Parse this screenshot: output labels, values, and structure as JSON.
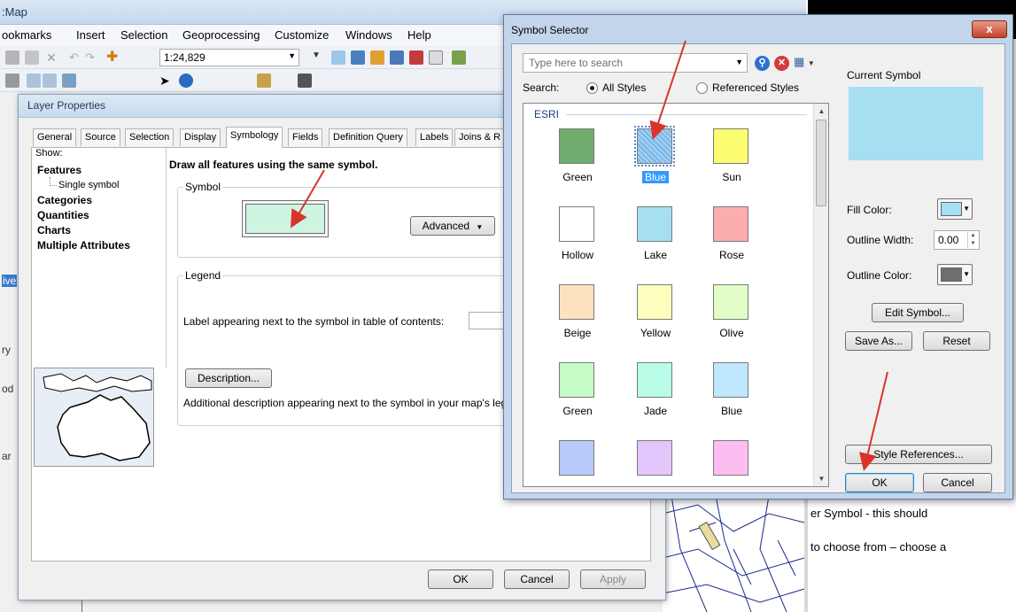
{
  "arcmap": {
    "title": ":Map",
    "menu": [
      "ookmarks",
      "Insert",
      "Selection",
      "Geoprocessing",
      "Customize",
      "Windows",
      "Help"
    ],
    "scale": "1:24,829",
    "left_edge_fragments": [
      "ive",
      "ry",
      "od",
      "ar"
    ]
  },
  "layer_properties": {
    "title": "Layer Properties",
    "tabs": [
      "General",
      "Source",
      "Selection",
      "Display",
      "Symbology",
      "Fields",
      "Definition Query",
      "Labels",
      "Joins & R"
    ],
    "active_tab": "Symbology",
    "show_label": "Show:",
    "tree": {
      "features": "Features",
      "single_symbol": "Single symbol",
      "categories": "Categories",
      "quantities": "Quantities",
      "charts": "Charts",
      "multiple_attributes": "Multiple Attributes"
    },
    "heading": "Draw all features using the same symbol.",
    "symbol_group": "Symbol",
    "advanced_button": "Advanced",
    "legend_group": "Legend",
    "legend_label": "Label appearing next to the symbol in table of contents:",
    "description_button": "Description...",
    "description_text": "Additional description appearing next to the symbol in your map's leg",
    "ok": "OK",
    "cancel": "Cancel",
    "apply": "Apply",
    "symbol_fill": "#cdf5e1"
  },
  "symbol_selector": {
    "title": "Symbol Selector",
    "close": "x",
    "search_placeholder": "Type here to search",
    "search_label": "Search:",
    "all_styles": "All Styles",
    "referenced_styles": "Referenced Styles",
    "group_header": "ESRI",
    "symbols": [
      {
        "name": "Green",
        "color": "#70ad6e"
      },
      {
        "name": "Blue",
        "color": "#77b7e8",
        "selected": true
      },
      {
        "name": "Sun",
        "color": "#fdfd72"
      },
      {
        "name": "Hollow",
        "color": "#ffffff"
      },
      {
        "name": "Lake",
        "color": "#a6def2"
      },
      {
        "name": "Rose",
        "color": "#fcadad"
      },
      {
        "name": "Beige",
        "color": "#fce3be"
      },
      {
        "name": "Yellow",
        "color": "#fdfdbe"
      },
      {
        "name": "Olive",
        "color": "#e2fcc6"
      },
      {
        "name": "Green",
        "color": "#c5fcc5"
      },
      {
        "name": "Jade",
        "color": "#b8fce7"
      },
      {
        "name": "Blue",
        "color": "#bee6fc"
      },
      {
        "name": "",
        "color": "#b9cafc"
      },
      {
        "name": "",
        "color": "#e2c6fc"
      },
      {
        "name": "",
        "color": "#fcbef0"
      }
    ],
    "current_symbol_label": "Current Symbol",
    "current_symbol_color": "#a6def2",
    "fill_color_label": "Fill Color:",
    "fill_color": "#a6def2",
    "outline_width_label": "Outline Width:",
    "outline_width": "0.00",
    "outline_color_label": "Outline Color:",
    "outline_color": "#6e6e6e",
    "edit_symbol": "Edit Symbol...",
    "save_as": "Save As...",
    "reset": "Reset",
    "style_references": "Style References...",
    "ok": "OK",
    "cancel": "Cancel"
  },
  "document": {
    "lines": [
      "er Symbol - this should",
      "to choose from – choose a"
    ]
  }
}
